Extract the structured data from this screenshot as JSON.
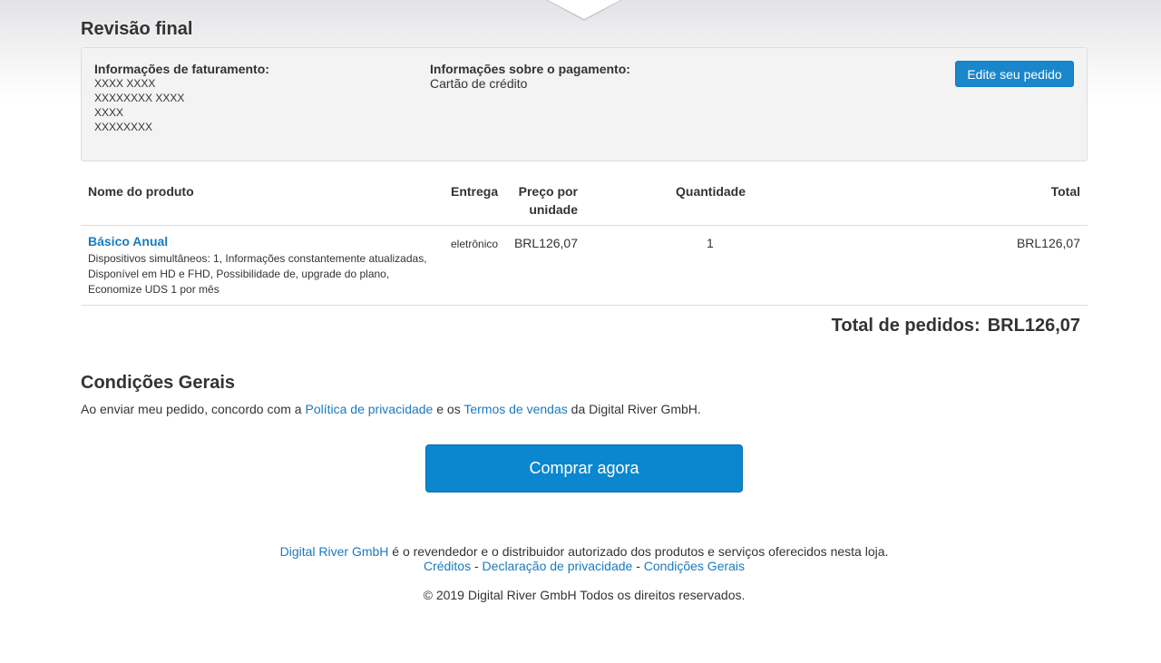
{
  "page": {
    "title": "Revisão final"
  },
  "billing": {
    "heading": "Informações de faturamento:",
    "lines": [
      "XXXX XXXX",
      "XXXXXXXX XXXX",
      "XXXX",
      "XXXXXXXX"
    ]
  },
  "payment": {
    "heading": "Informações sobre o pagamento:",
    "method": "Cartão de crédito"
  },
  "edit_button": "Edite seu pedido",
  "table": {
    "headers": {
      "product": "Nome do produto",
      "delivery": "Entrega",
      "unit_price_1": "Preço por",
      "unit_price_2": "unidade",
      "quantity": "Quantidade",
      "total": "Total"
    },
    "rows": [
      {
        "name": "Básico Anual",
        "description": "Dispositivos simultâneos: 1, Informações constantemente atualizadas, Disponível em HD e FHD, Possibilidade de, upgrade do plano, Economize UDS 1 por mês",
        "delivery": "eletrônico",
        "unit_price": "BRL126,07",
        "quantity": "1",
        "total": "BRL126,07"
      }
    ]
  },
  "order_total": {
    "label": "Total de pedidos:",
    "value": "BRL126,07"
  },
  "conditions": {
    "heading": "Condições Gerais",
    "text_before": "Ao enviar meu pedido, concordo com a ",
    "privacy_link": "Política de privacidade",
    "text_middle": " e os ",
    "terms_link": "Termos de vendas",
    "text_after": " da Digital River GmbH."
  },
  "buy_button": "Comprar agora",
  "footer": {
    "company_link": "Digital River GmbH",
    "reseller_text": " é o revendedor e o distribuidor autorizado dos produtos e serviços oferecidos nesta loja.",
    "credits": "Créditos",
    "privacy": "Declaração de privacidade",
    "terms": "Condições Gerais",
    "separator": " - ",
    "copyright": "© 2019 Digital River GmbH Todos os direitos reservados."
  },
  "colors": {
    "accent": "#1a7abf",
    "button": "#0a87cf"
  }
}
